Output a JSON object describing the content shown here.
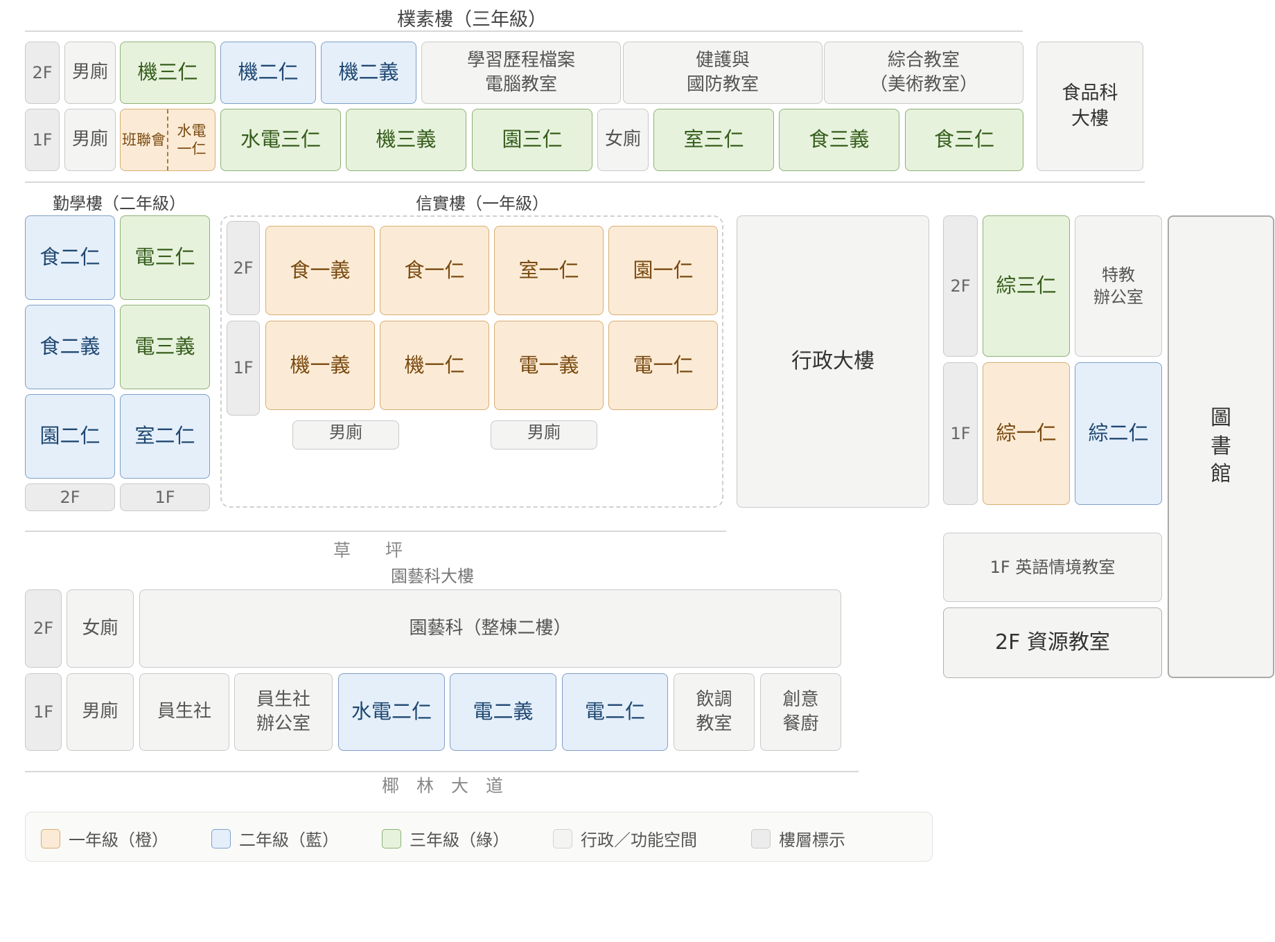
{
  "third_building": {
    "title": "樸素樓（三年級）",
    "floor2": {
      "label": "2F",
      "rooms": [
        "男廁",
        "機三仁",
        "機二仁",
        "機二義",
        "學習歷程檔案\n電腦教室",
        "健護與\n國防教室",
        "綜合教室\n（美術教室）"
      ]
    },
    "floor1": {
      "label": "1F",
      "rooms": [
        "男廁",
        "水電三仁",
        "機三義",
        "園三仁",
        "女廁",
        "室三仁",
        "食三義",
        "食三仁"
      ],
      "split_left": "班聯會",
      "split_right": "水電\n一仁"
    },
    "food_building": "食品科\n大樓"
  },
  "second_building": {
    "title": "勤學樓（二年級）",
    "rooms": [
      "食二仁",
      "電三仁",
      "食二義",
      "電三義",
      "園二仁",
      "室二仁"
    ],
    "floor_labels": [
      "2F",
      "1F"
    ]
  },
  "first_building": {
    "title": "信實樓（一年級）",
    "floor2_label": "2F",
    "floor1_label": "1F",
    "floor2": [
      "食一義",
      "食一仁",
      "室一仁",
      "園一仁"
    ],
    "floor1": [
      "機一義",
      "機一仁",
      "電一義",
      "電一仁"
    ],
    "toilets": [
      "男廁",
      "男廁"
    ]
  },
  "admin_building": "行政大樓",
  "east_building": {
    "floor2_label": "2F",
    "floor1_label": "1F",
    "floor2": [
      "綜三仁",
      "特教\n辦公室"
    ],
    "floor1": [
      "綜一仁",
      "綜二仁"
    ],
    "english_room": "1F 英語情境教室",
    "resource_room": "2F 資源教室"
  },
  "library": "圖\n書\n館",
  "lawn": "草　　坪",
  "horticulture": {
    "title": "園藝科大樓",
    "floor2_label": "2F",
    "floor2_toilet": "女廁",
    "floor2_main": "園藝科（整棟二樓）",
    "floor1_label": "1F",
    "floor1": [
      "男廁",
      "員生社",
      "員生社\n辦公室",
      "水電二仁",
      "電二義",
      "電二仁",
      "飲調\n教室",
      "創意\n餐廚"
    ]
  },
  "avenue": "椰　林　大　道",
  "legend": [
    {
      "label": "一年級（橙）",
      "color": "#fbebd6",
      "border": "#d8ad73"
    },
    {
      "label": "二年級（藍）",
      "color": "#e5effa",
      "border": "#7e9fc6"
    },
    {
      "label": "三年級（綠）",
      "color": "#e7f2dd",
      "border": "#8cb173"
    },
    {
      "label": "行政／功能空間",
      "color": "#f4f4f3",
      "border": "#d3d3d3"
    },
    {
      "label": "樓層標示",
      "color": "#ececec",
      "border": "#c9c9c9"
    }
  ]
}
